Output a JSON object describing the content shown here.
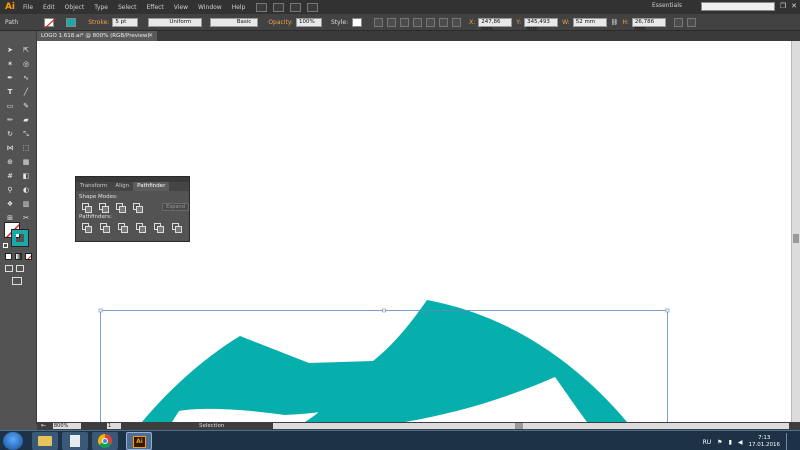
{
  "app": {
    "logo": "Ai"
  },
  "menu": [
    "File",
    "Edit",
    "Object",
    "Type",
    "Select",
    "Effect",
    "View",
    "Window",
    "Help"
  ],
  "workspace": "Essentials",
  "window_controls": {
    "minimize": "–",
    "restore": "❐",
    "close": "✕"
  },
  "control_bar": {
    "selection_type": "Path",
    "stroke_label": "Stroke:",
    "stroke_weight": "5 pt",
    "profile": "Uniform",
    "brush": "Basic",
    "opacity_label": "Opacity:",
    "opacity_value": "100%",
    "style_label": "Style:",
    "x_label": "X:",
    "x_value": "247,86 mm",
    "y_label": "Y:",
    "y_value": "345,493 mm",
    "w_label": "W:",
    "w_value": "52 mm",
    "h_label": "H:",
    "h_value": "26,786 mm"
  },
  "document_tab": {
    "title": "LOGO 1.618.ai* @ 800% (RGB/Preview)",
    "close": "✕"
  },
  "pathfinder": {
    "tabs": [
      "Transform",
      "Align",
      "Pathfinder"
    ],
    "active_tab": "Pathfinder",
    "shape_modes_label": "Shape Modes:",
    "expand_label": "Expand",
    "pathfinders_label": "Pathfinders:"
  },
  "status_bar": {
    "zoom": "800%",
    "page": "1",
    "status": "Selection"
  },
  "tray": {
    "language": "RU",
    "time": "7:13",
    "date": "17.01.2016"
  },
  "colors": {
    "artwork_teal": "#06aeac",
    "stroke_swatch": "#19a9a8",
    "accent_orange": "#ff9a00"
  },
  "icons": {
    "tools": [
      "selection-icon",
      "direct-selection-icon",
      "magic-wand-icon",
      "lasso-icon",
      "pen-icon",
      "curvature-icon",
      "type-icon",
      "line-icon",
      "rectangle-icon",
      "paintbrush-icon",
      "pencil-icon",
      "eraser-icon",
      "rotate-icon",
      "scale-icon",
      "width-icon",
      "free-transform-icon",
      "shape-builder-icon",
      "perspective-icon",
      "mesh-icon",
      "gradient-icon",
      "eyedropper-icon",
      "blend-icon",
      "symbol-sprayer-icon",
      "column-graph-icon",
      "artboard-icon",
      "slice-icon",
      "hand-icon",
      "zoom-icon"
    ]
  }
}
